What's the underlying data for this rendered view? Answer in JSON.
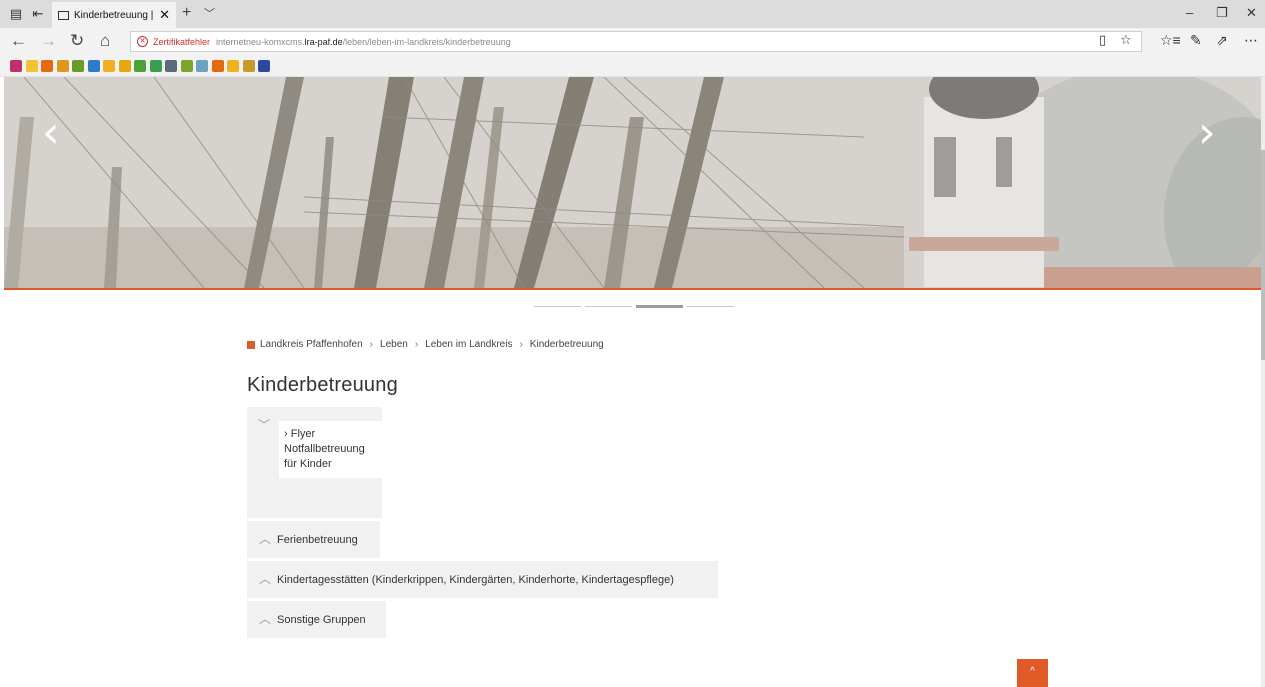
{
  "browser": {
    "tab_title": "Kinderbetreuung | In Ba",
    "tab_close": "✕",
    "new_tab": "+",
    "tab_list": "﹀",
    "window_controls": {
      "minimize": "–",
      "restore": "❐",
      "close": "✕"
    }
  },
  "navigation": {
    "back": "←",
    "forward": "→",
    "refresh": "↻",
    "home": "⌂"
  },
  "address_bar": {
    "cert_error": "Zertifikatfehler",
    "url_prefix": "internetneu-komxcms.",
    "url_host": "lra-paf.de",
    "url_path": "/leben/leben-im-landkreis/kinderbetreuung",
    "reading_view": "▯",
    "favorite": "☆"
  },
  "toolbar": {
    "favorites_hub": "☆≡",
    "notes": "✎",
    "share": "⇗",
    "more": "⋯"
  },
  "favorites_bar": {
    "colors": [
      "#c0306a",
      "#f2c230",
      "#e36a10",
      "#e0961a",
      "#6b9a2a",
      "#2e7bc8",
      "#f0b020",
      "#e9a50c",
      "#4ca13a",
      "#3a9e50",
      "#5a6a7a",
      "#7ca32a",
      "#6aa2c0",
      "#e36a10",
      "#f0b020",
      "#c89a2a",
      "#2a4aa0"
    ]
  },
  "hero": {
    "prev_arrow": "‹",
    "next_arrow": "›",
    "slide_count": 4,
    "active_slide": 3
  },
  "breadcrumb": {
    "items": [
      "Landkreis Pfaffenhofen",
      "Leben",
      "Leben im Landkreis",
      "Kinderbetreuung"
    ],
    "separator": "›"
  },
  "page": {
    "title": "Kinderbetreuung"
  },
  "accordion": {
    "expanded_chevron": "﹀",
    "collapsed_chevron": "︿",
    "open_item_link": "› Flyer Notfallbetreuung für Kinder",
    "items": [
      {
        "label": "Ferienbetreuung"
      },
      {
        "label": "Kindertagesstätten (Kinderkrippen, Kindergärten, Kinderhorte, Kindertagespflege)"
      },
      {
        "label": "Sonstige Gruppen"
      }
    ]
  },
  "back_to_top": "^",
  "colors": {
    "accent": "#e05a27"
  }
}
